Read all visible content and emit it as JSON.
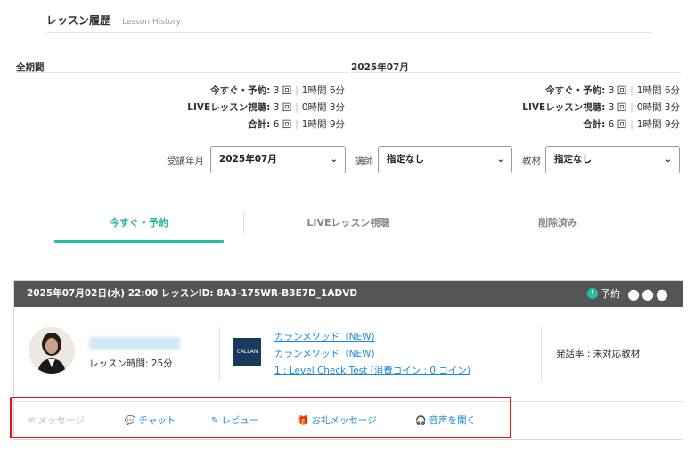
{
  "header": {
    "title": "レッスン履歴",
    "subtitle": "Lesson History"
  },
  "periods": {
    "left": {
      "title": "全期間",
      "rows": [
        {
          "label": "今すぐ・予約",
          "count": "3 回",
          "time": "1時間 6分"
        },
        {
          "label": "LIVEレッスン視聴",
          "count": "3 回",
          "time": "0時間 3分"
        },
        {
          "label": "合計",
          "count": "6 回",
          "time": "1時間 9分"
        }
      ]
    },
    "right": {
      "title": "2025年07月",
      "rows": [
        {
          "label": "今すぐ・予約",
          "count": "3 回",
          "time": "1時間 6分"
        },
        {
          "label": "LIVEレッスン視聴",
          "count": "3 回",
          "time": "0時間 3分"
        },
        {
          "label": "合計",
          "count": "6 回",
          "time": "1時間 9分"
        }
      ]
    }
  },
  "filters": {
    "month_label": "受講年月",
    "month_value": "2025年07月",
    "teacher_label": "講師",
    "teacher_value": "指定なし",
    "material_label": "教材",
    "material_value": "指定なし"
  },
  "tabs": [
    {
      "label": "今すぐ・予約",
      "active": true
    },
    {
      "label": "LIVEレッスン視聴",
      "active": false
    },
    {
      "label": "削除済み",
      "active": false
    }
  ],
  "lesson": {
    "header": "2025年07月02日(水) 22:00 レッスンID: 8A3-175WR-B3E7D_1ADVD",
    "status": "予約",
    "more": "●●●",
    "lesson_time": "レッスン時間: 25分",
    "book_icon_text": "CALLAN",
    "links": [
      "カランメソッド（NEW)",
      "カランメソッド（NEW)",
      "1 : Level Check Test (消費コイン : 0 コイン)"
    ],
    "speak_rate": "発話率 : 未対応教材"
  },
  "actions": [
    {
      "label": "メッセージ",
      "icon": "envelope-icon",
      "disabled": true
    },
    {
      "label": "チャット",
      "icon": "chat-icon",
      "disabled": false
    },
    {
      "label": "レビュー",
      "icon": "review-icon",
      "disabled": false
    },
    {
      "label": "お礼メッセージ",
      "icon": "gift-icon",
      "disabled": false
    },
    {
      "label": "音声を聞く",
      "icon": "headphones-icon",
      "disabled": false
    }
  ],
  "colors": {
    "accent": "#20c0a0",
    "link": "#1a8ad8",
    "header_bg": "#555555",
    "highlight": "#e01616"
  }
}
